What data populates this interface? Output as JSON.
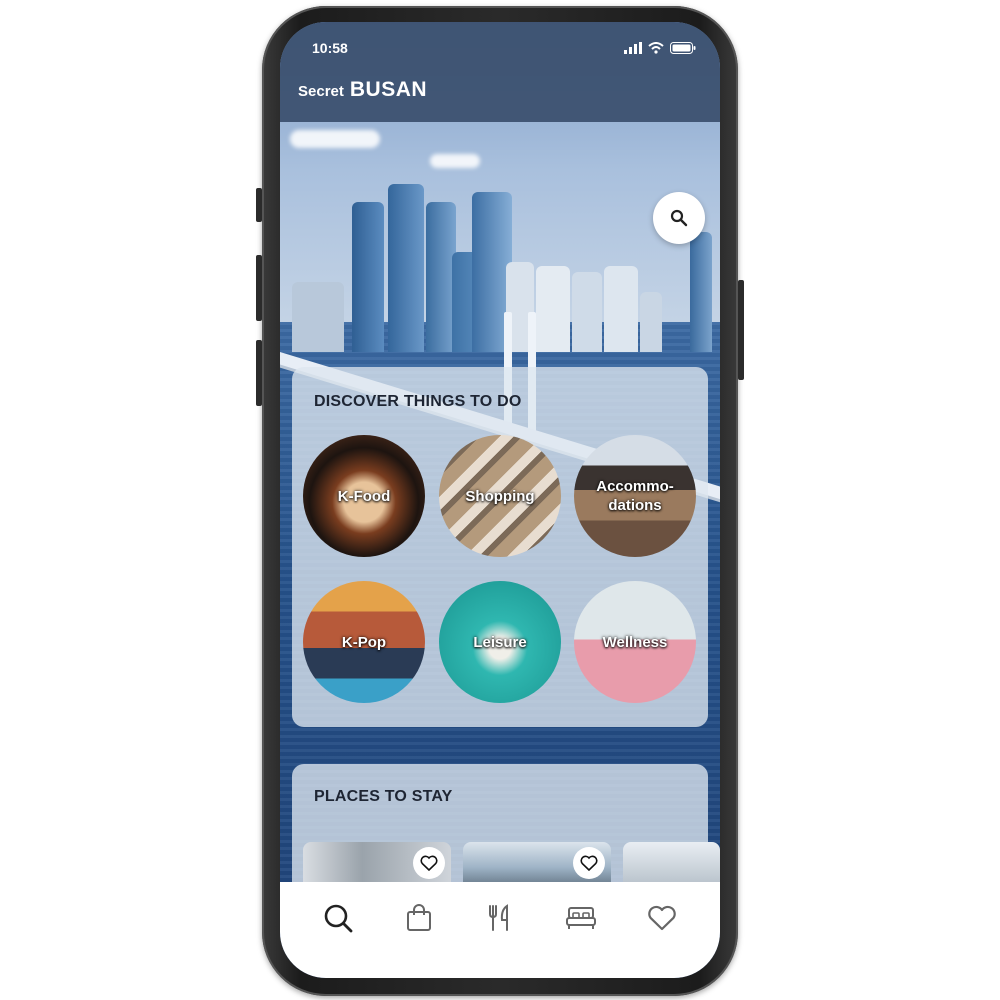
{
  "status_bar": {
    "time": "10:58"
  },
  "header": {
    "title_small": "Secret",
    "title_big": "BUSAN"
  },
  "discover": {
    "title": "DISCOVER THINGS TO DO",
    "categories": [
      {
        "label": "K-Food"
      },
      {
        "label": "Shopping"
      },
      {
        "label": "Accommo-\ndations"
      },
      {
        "label": "K-Pop"
      },
      {
        "label": "Leisure"
      },
      {
        "label": "Wellness"
      }
    ]
  },
  "places": {
    "title": "PLACES TO STAY"
  },
  "bottom_nav": {
    "items": [
      {
        "icon": "search-icon",
        "active": true
      },
      {
        "icon": "shopping-bag-icon",
        "active": false
      },
      {
        "icon": "fork-knife-icon",
        "active": false
      },
      {
        "icon": "bed-icon",
        "active": false
      },
      {
        "icon": "heart-icon",
        "active": false
      }
    ]
  },
  "colors": {
    "header": "#3a4e6c",
    "card": "#dee7f0",
    "nav_icon": "#555555",
    "nav_active": "#222222"
  }
}
